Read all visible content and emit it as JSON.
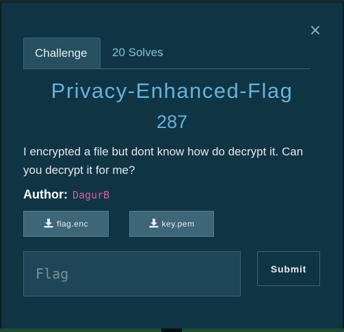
{
  "modal": {
    "close_glyph": "×",
    "tabs": [
      {
        "label": "Challenge",
        "active": true
      },
      {
        "label": "20 Solves",
        "active": false
      }
    ],
    "title": "Privacy-Enhanced-Flag",
    "points": "287",
    "description": "I encrypted a file but dont know how do decrypt it. Can you decrypt it for me?",
    "author_label": "Author:",
    "author_name": "DagurB",
    "files": [
      {
        "label": "flag.enc",
        "icon": "download-icon"
      },
      {
        "label": "key.pem",
        "icon": "download-icon"
      }
    ],
    "flag_placeholder": "Flag",
    "submit_label": "Submit"
  },
  "colors": {
    "modal_bg": "#0f3444",
    "title": "#63b4dd",
    "author_name": "#e25a9a",
    "tab_active_bg": "#264f60",
    "tab_inactive_text": "#7fc4dc"
  }
}
